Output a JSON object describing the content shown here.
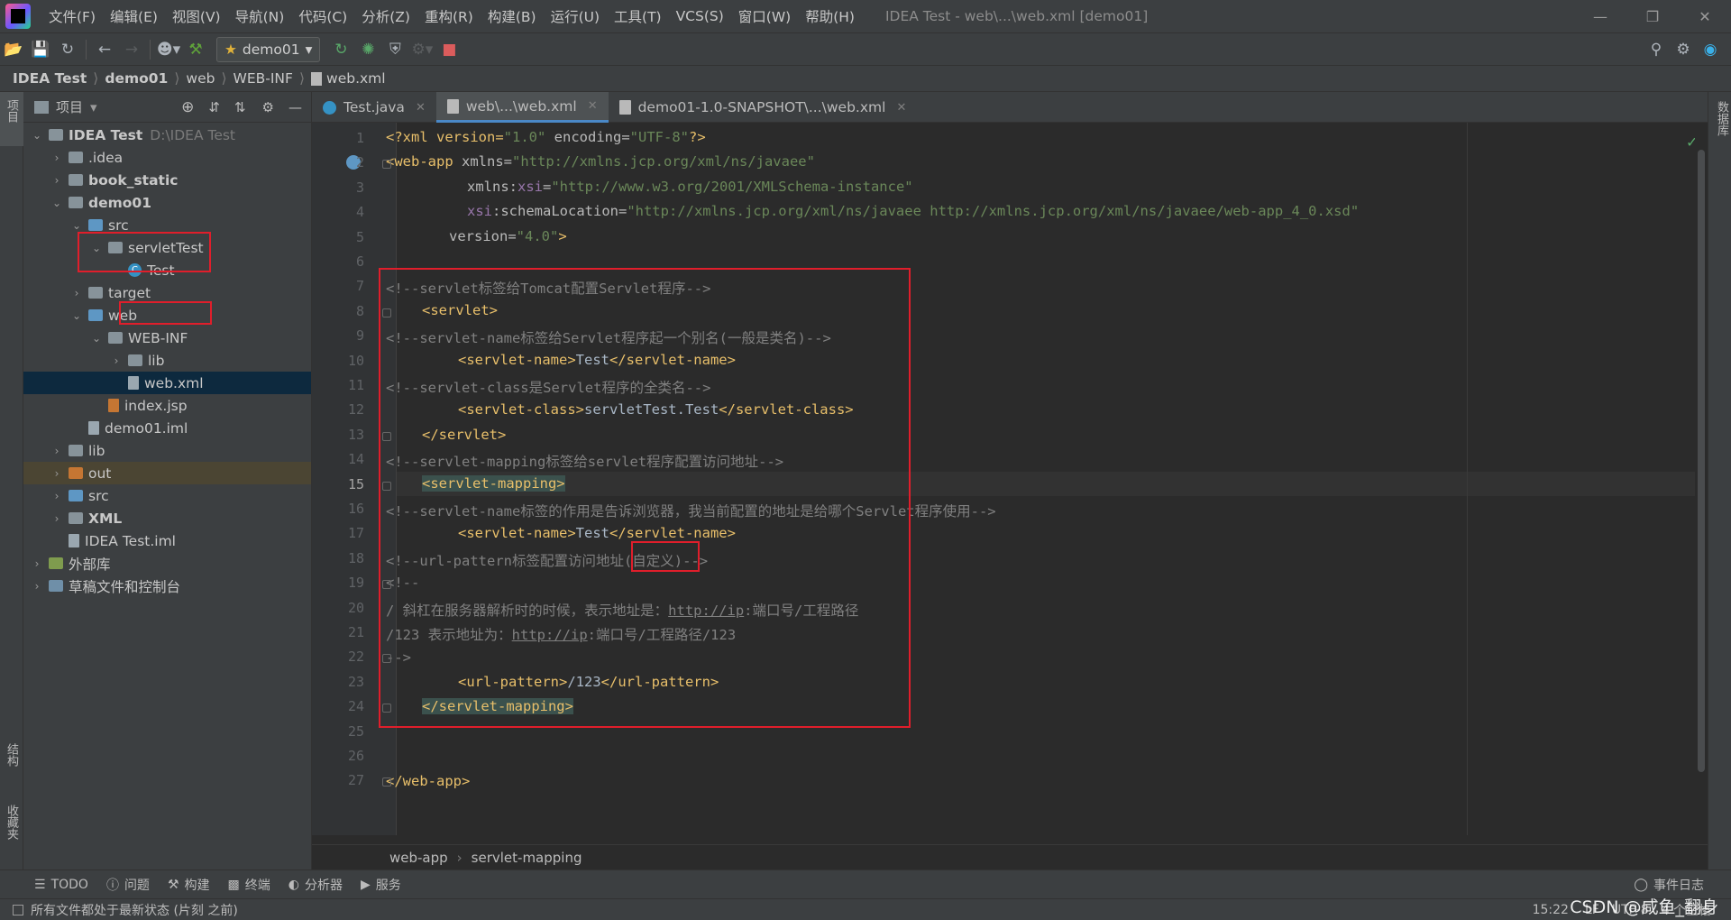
{
  "menubar": {
    "items": [
      "文件(F)",
      "编辑(E)",
      "视图(V)",
      "导航(N)",
      "代码(C)",
      "分析(Z)",
      "重构(R)",
      "构建(B)",
      "运行(U)",
      "工具(T)",
      "VCS(S)",
      "窗口(W)",
      "帮助(H)"
    ],
    "title": "IDEA Test - web\\...\\web.xml [demo01]"
  },
  "toolbar": {
    "run_config": "demo01"
  },
  "breadcrumb": [
    "IDEA Test",
    "demo01",
    "web",
    "WEB-INF",
    "web.xml"
  ],
  "project_panel": {
    "title": "项目",
    "tree": [
      {
        "label": "IDEA Test",
        "hint": "D:\\IDEA Test"
      },
      {
        "label": ".idea"
      },
      {
        "label": "book_static"
      },
      {
        "label": "demo01"
      },
      {
        "label": "src"
      },
      {
        "label": "servletTest"
      },
      {
        "label": "Test"
      },
      {
        "label": "target"
      },
      {
        "label": "web"
      },
      {
        "label": "WEB-INF"
      },
      {
        "label": "lib"
      },
      {
        "label": "web.xml"
      },
      {
        "label": "index.jsp"
      },
      {
        "label": "demo01.iml"
      },
      {
        "label": "lib"
      },
      {
        "label": "out"
      },
      {
        "label": "src"
      },
      {
        "label": "XML"
      },
      {
        "label": "IDEA Test.iml"
      },
      {
        "label": "外部库"
      },
      {
        "label": "草稿文件和控制台"
      }
    ]
  },
  "left_strip": {
    "project": "项目",
    "structure": "结构",
    "favorites": "收藏夹"
  },
  "right_strip": {
    "database": "数据库"
  },
  "tabs": [
    "Test.java",
    "web\\...\\web.xml",
    "demo01-1.0-SNAPSHOT\\...\\web.xml"
  ],
  "code": {
    "l1": {
      "a": "<?xml version=",
      "b": "\"1.0\"",
      "c": " encoding=",
      "d": "\"UTF-8\"",
      "e": "?>"
    },
    "l2": {
      "a": "<web-app ",
      "b": "xmlns=",
      "c": "\"http://xmlns.jcp.org/xml/ns/javaee\""
    },
    "l3": {
      "a": "xmlns:",
      "b": "xsi",
      "c": "=",
      "d": "\"http://www.w3.org/2001/XMLSchema-instance\""
    },
    "l4": {
      "a": "xsi",
      "b": ":schemaLocation=",
      "c": "\"http://xmlns.jcp.org/xml/ns/javaee http://xmlns.jcp.org/xml/ns/javaee/web-app_4_0.xsd\""
    },
    "l5": {
      "a": "version=",
      "b": "\"4.0\"",
      "c": ">"
    },
    "l7": "<!--servlet标签给Tomcat配置Servlet程序-->",
    "l8": "<servlet>",
    "l9": "<!--servlet-name标签给Servlet程序起一个别名(一般是类名)-->",
    "l10": {
      "a": "<servlet-name>",
      "b": "Test",
      "c": "</servlet-name>"
    },
    "l11": "<!--servlet-class是Servlet程序的全类名-->",
    "l12": {
      "a": "<servlet-class>",
      "b": "servletTest.Test",
      "c": "</servlet-class>"
    },
    "l13": "</servlet>",
    "l14": "<!--servlet-mapping标签给servlet程序配置访问地址-->",
    "l15": "<servlet-mapping>",
    "l16": "<!--servlet-name标签的作用是告诉浏览器，我当前配置的地址是给哪个Servlet程序使用-->",
    "l17": {
      "a": "<servlet-name>",
      "b": "Test",
      "c": "</servlet-name>"
    },
    "l18": "<!--url-pattern标签配置访问地址(自定义)-->",
    "l19": "<!--",
    "l20": {
      "a": "/ 斜杠在服务器解析时的时候，表示地址是：",
      "b": "http://ip",
      "c": ":端口号/工程路径"
    },
    "l21": {
      "a": "/123 表示地址为：",
      "b": "http://ip",
      "c": ":端口号/工程路径/123"
    },
    "l22": "-->",
    "l23": {
      "a": "<url-pattern>",
      "b": "/123",
      "c": "</url-pattern>"
    },
    "l24": "</servlet-mapping>",
    "l27": "</web-app>"
  },
  "line_numbers": [
    "1",
    "2",
    "3",
    "4",
    "5",
    "6",
    "7",
    "8",
    "9",
    "10",
    "11",
    "12",
    "13",
    "14",
    "15",
    "16",
    "17",
    "18",
    "19",
    "20",
    "21",
    "22",
    "23",
    "24",
    "25",
    "26",
    "27"
  ],
  "editor_breadcrumb": [
    "web-app",
    "servlet-mapping"
  ],
  "tool_windows": [
    "TODO",
    "问题",
    "构建",
    "终端",
    "分析器",
    "服务"
  ],
  "event_log": "事件日志",
  "status": {
    "message": "所有文件都处于最新状态 (片刻 之前)",
    "position": "15:22",
    "line_sep": "LF",
    "encoding": "UTF-8",
    "indent": "4 个空格"
  },
  "watermark": "CSDN @咸鱼_翻身"
}
